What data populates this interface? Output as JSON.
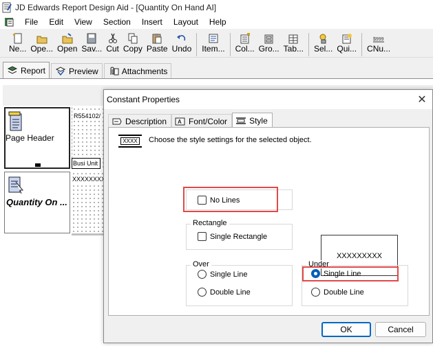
{
  "window": {
    "title": "JD Edwards Report Design Aid - [Quantity On Hand AI]"
  },
  "menu": [
    "File",
    "Edit",
    "View",
    "Section",
    "Insert",
    "Layout",
    "Help"
  ],
  "toolbar": {
    "groups": [
      [
        {
          "label": "Ne...",
          "icon": "new-icon"
        },
        {
          "label": "Ope...",
          "icon": "open-icon"
        },
        {
          "label": "Open",
          "icon": "open-folder-icon"
        },
        {
          "label": "Sav...",
          "icon": "save-icon"
        },
        {
          "label": "Cut",
          "icon": "cut-icon"
        },
        {
          "label": "Copy",
          "icon": "copy-icon"
        },
        {
          "label": "Paste",
          "icon": "paste-icon"
        },
        {
          "label": "Undo",
          "icon": "undo-icon"
        }
      ],
      [
        {
          "label": "Item...",
          "icon": "item-icon"
        }
      ],
      [
        {
          "label": "Col...",
          "icon": "column-icon"
        },
        {
          "label": "Gro...",
          "icon": "group-icon"
        },
        {
          "label": "Tab...",
          "icon": "tabular-icon"
        }
      ],
      [
        {
          "label": "Sel...",
          "icon": "select-icon"
        },
        {
          "label": "Qui...",
          "icon": "quick-icon"
        }
      ],
      [
        {
          "label": "CNu...",
          "icon": "constant-number-icon"
        }
      ]
    ]
  },
  "design_tabs": [
    {
      "label": "Report",
      "icon": "report-icon",
      "active": true
    },
    {
      "label": "Preview",
      "icon": "preview-icon",
      "active": false
    },
    {
      "label": "Attachments",
      "icon": "attachments-icon",
      "active": false
    }
  ],
  "sections": {
    "header_label": "Page Header",
    "body_label": "Quantity On ...",
    "field_header_top": "R554102/",
    "field_header_sel": "Busi Unit",
    "field_body": "XXXXXXXXXX"
  },
  "dialog": {
    "title": "Constant Properties",
    "tabs": [
      {
        "label": "Description",
        "icon": "description-icon",
        "active": false
      },
      {
        "label": "Font/Color",
        "icon": "font-color-icon",
        "active": false
      },
      {
        "label": "Style",
        "icon": "style-icon",
        "active": true
      }
    ],
    "description": "Choose the style settings for the selected object.",
    "panel_icon_text": "XXXX",
    "no_lines": {
      "label": "No Lines",
      "checked": false
    },
    "rectangle": {
      "title": "Rectangle",
      "single_rectangle": {
        "label": "Single Rectangle",
        "checked": false
      }
    },
    "over": {
      "title": "Over",
      "options": [
        {
          "label": "Single Line",
          "selected": false
        },
        {
          "label": "Double Line",
          "selected": false
        }
      ]
    },
    "under": {
      "title": "Under",
      "options": [
        {
          "label": "Single Line",
          "selected": true
        },
        {
          "label": "Double Line",
          "selected": false
        }
      ]
    },
    "preview_text": "XXXXXXXXX",
    "ok": "OK",
    "cancel": "Cancel"
  },
  "colors": {
    "highlight": "#e04848",
    "accent": "#005fb8"
  }
}
